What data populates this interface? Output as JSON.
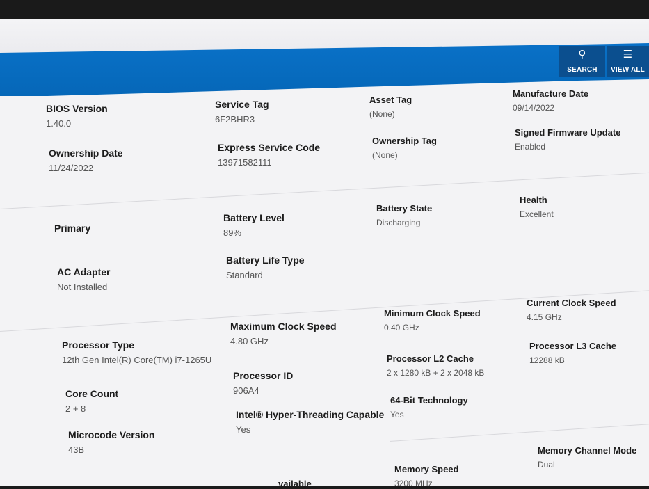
{
  "toolbar": {
    "search_label": "SEARCH",
    "view_all_label": "VIEW ALL"
  },
  "system": {
    "bios_version": {
      "label": "BIOS Version",
      "value": "1.40.0"
    },
    "service_tag": {
      "label": "Service Tag",
      "value": "6F2BHR3"
    },
    "asset_tag": {
      "label": "Asset Tag",
      "value": "(None)"
    },
    "manufacture_date": {
      "label": "Manufacture Date",
      "value": "09/14/2022"
    },
    "ownership_date": {
      "label": "Ownership Date",
      "value": "11/24/2022"
    },
    "express_service_code": {
      "label": "Express Service Code",
      "value": "13971582111"
    },
    "ownership_tag": {
      "label": "Ownership Tag",
      "value": "(None)"
    },
    "signed_firmware_update": {
      "label": "Signed Firmware Update",
      "value": "Enabled"
    }
  },
  "battery": {
    "primary": {
      "label": "Primary"
    },
    "battery_level": {
      "label": "Battery Level",
      "value": "89%"
    },
    "battery_state": {
      "label": "Battery State",
      "value": "Discharging"
    },
    "health": {
      "label": "Health",
      "value": "Excellent"
    },
    "ac_adapter": {
      "label": "AC Adapter",
      "value": "Not Installed"
    },
    "battery_life_type": {
      "label": "Battery Life Type",
      "value": "Standard"
    }
  },
  "processor": {
    "processor_type": {
      "label": "Processor Type",
      "value": "12th Gen Intel(R) Core(TM) i7-1265U"
    },
    "max_clock": {
      "label": "Maximum Clock Speed",
      "value": "4.80 GHz"
    },
    "min_clock": {
      "label": "Minimum Clock Speed",
      "value": "0.40 GHz"
    },
    "current_clock": {
      "label": "Current Clock Speed",
      "value": "4.15 GHz"
    },
    "core_count": {
      "label": "Core Count",
      "value": "2 + 8"
    },
    "processor_id": {
      "label": "Processor ID",
      "value": "906A4"
    },
    "l2_cache": {
      "label": "Processor L2 Cache",
      "value": "2 x 1280  kB + 2 x 2048  kB"
    },
    "l3_cache": {
      "label": "Processor L3 Cache",
      "value": "12288 kB"
    },
    "microcode": {
      "label": "Microcode Version",
      "value": "43B"
    },
    "hyperthreading": {
      "label": "Intel® Hyper-Threading Capable",
      "value": "Yes"
    },
    "bit64": {
      "label": "64-Bit Technology",
      "value": "Yes"
    }
  },
  "memory": {
    "available_partial": {
      "label": "vailable"
    },
    "memory_speed": {
      "label": "Memory Speed",
      "value": "3200 MHz"
    },
    "channel_mode": {
      "label": "Memory Channel Mode",
      "value": "Dual"
    }
  }
}
